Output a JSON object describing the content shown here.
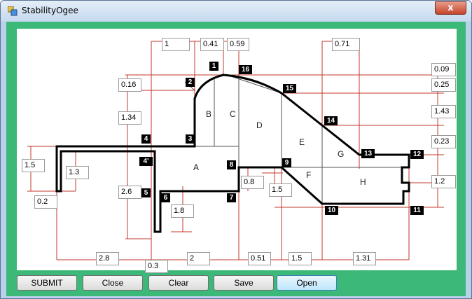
{
  "window": {
    "title": "StabilityOgee",
    "close_glyph": "x",
    "icon": "app-window-icon"
  },
  "buttons": {
    "submit": "SUBMIT",
    "close": "Close",
    "clear": "Clear",
    "save": "Save",
    "open": "Open"
  },
  "dimensions": {
    "top_1": "1",
    "top_041": "0.41",
    "top_059": "0.59",
    "top_071": "0.71",
    "left_016": "0.16",
    "left_134": "1.34",
    "left_15": "1.5",
    "left_13": "1.3",
    "left_02": "0.2",
    "left_26": "2.6",
    "left_18": "1.8",
    "right_009": "0.09",
    "right_025": "0.25",
    "right_143": "1.43",
    "right_023": "0.23",
    "right_12": "1.2",
    "mid_08": "0.8",
    "mid_15": "1.5",
    "bottom_28": "2.8",
    "bottom_03": "0.3",
    "bottom_2": "2",
    "bottom_051": "0.51",
    "bottom_15": "1.5",
    "bottom_131": "1.31"
  },
  "nodes": [
    "1",
    "2",
    "3",
    "4",
    "4'",
    "5",
    "6",
    "7",
    "8",
    "9",
    "10",
    "11",
    "12",
    "13",
    "14",
    "15",
    "16"
  ],
  "zones": [
    "A",
    "B",
    "C",
    "D",
    "E",
    "F",
    "G",
    "H"
  ],
  "colors": {
    "background_green": "#3cb878",
    "dimension_line": "#c0392b",
    "section_line": "#000000"
  }
}
